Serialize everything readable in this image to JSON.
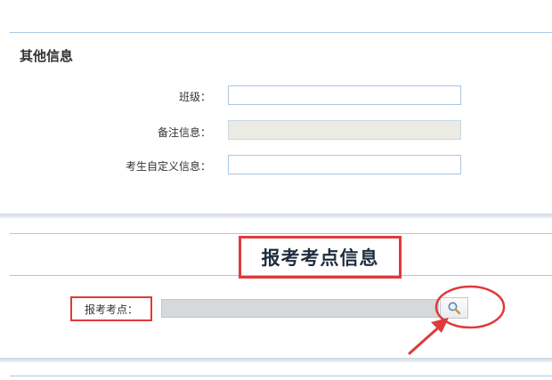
{
  "other_info": {
    "title": "其他信息",
    "fields": [
      {
        "label": "班级：",
        "value": "",
        "disabled": false
      },
      {
        "label": "备注信息：",
        "value": "",
        "disabled": true
      },
      {
        "label": "考生自定义信息：",
        "value": "",
        "disabled": false
      }
    ]
  },
  "exam_site": {
    "title": "报考考点信息",
    "label": "报考考点：",
    "value": "",
    "search_icon": "magnifier-icon"
  },
  "annotation": {
    "color": "#e03a3a"
  }
}
